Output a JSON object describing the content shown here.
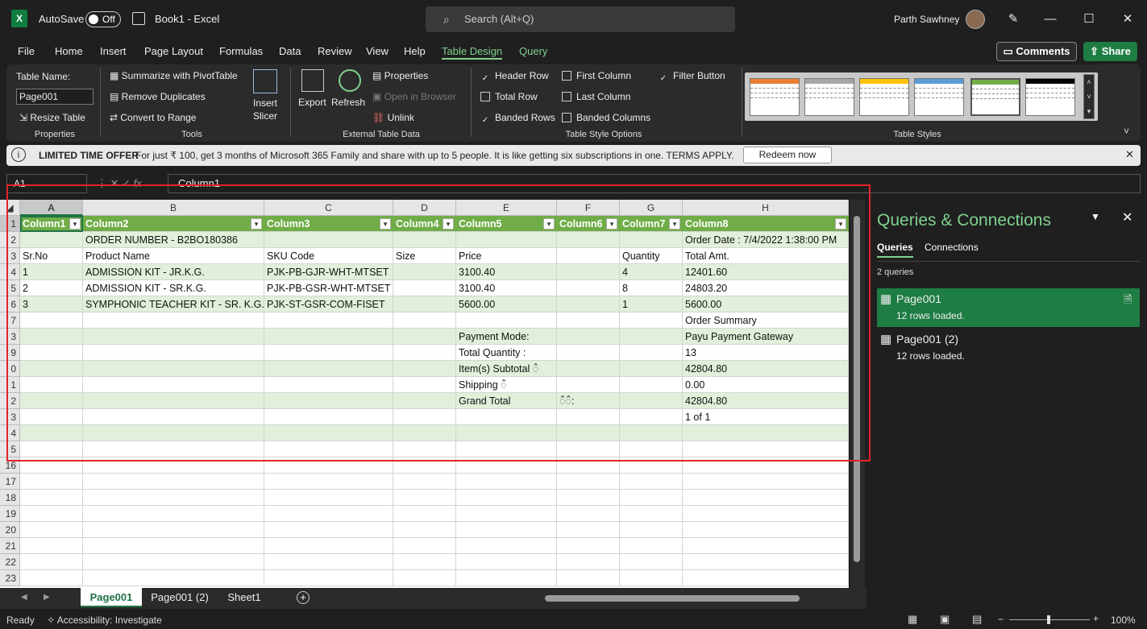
{
  "titlebar": {
    "autosave": "AutoSave",
    "toggle": "Off",
    "doc": "Book1  -  Excel",
    "search": "Search (Alt+Q)",
    "user": "Parth Sawhney"
  },
  "menu": {
    "items": [
      "File",
      "Home",
      "Insert",
      "Page Layout",
      "Formulas",
      "Data",
      "Review",
      "View",
      "Help",
      "Table Design",
      "Query"
    ],
    "comments": "Comments",
    "share": "Share"
  },
  "ribbon": {
    "properties": {
      "table_name_label": "Table Name:",
      "table_name": "Page001",
      "resize": "Resize Table",
      "group": "Properties"
    },
    "tools": {
      "pivot": "Summarize with PivotTable",
      "dupes": "Remove Duplicates",
      "convert": "Convert to Range",
      "slicer": "Insert Slicer",
      "group": "Tools"
    },
    "external": {
      "export": "Export",
      "refresh": "Refresh",
      "properties": "Properties",
      "open_browser": "Open in Browser",
      "unlink": "Unlink",
      "group": "External Table Data"
    },
    "style_options": {
      "header_row": "Header Row",
      "total_row": "Total Row",
      "banded_rows": "Banded Rows",
      "first_column": "First Column",
      "last_column": "Last Column",
      "banded_columns": "Banded Columns",
      "filter_button": "Filter Button",
      "group": "Table Style Options"
    },
    "styles": {
      "group": "Table Styles"
    }
  },
  "infobar": {
    "title": "LIMITED TIME OFFER",
    "message": "For just ₹ 100, get 3 months of Microsoft 365 Family and share with up to 5 people. It is like getting six subscriptions in one. TERMS APPLY.",
    "button": "Redeem now"
  },
  "formula": {
    "namebox": "A1",
    "value": "Column1",
    "fx": "fx"
  },
  "columns": [
    "A",
    "B",
    "C",
    "D",
    "E",
    "F",
    "G",
    "H"
  ],
  "rows": [
    "1",
    "2",
    "3",
    "4",
    "5",
    "6",
    "7",
    "8",
    "9",
    "10",
    "11",
    "12",
    "13",
    "14",
    "15",
    "16",
    "17",
    "18",
    "19",
    "20",
    "21",
    "22",
    "23"
  ],
  "rows_visible": [
    "1",
    "2",
    "3",
    "4",
    "5",
    "6",
    "7",
    "3",
    "9",
    "0",
    "1",
    "2",
    "3",
    "4",
    "5",
    "16",
    "17",
    "18",
    "19",
    "20",
    "21",
    "22",
    "23"
  ],
  "table": [
    [
      "Column1",
      "Column2",
      "Column3",
      "Column4",
      "Column5",
      "Column6",
      "Column7",
      "Column8"
    ],
    [
      "",
      "ORDER NUMBER - B2BO180386",
      "",
      "",
      "",
      "",
      "",
      "Order Date : 7/4/2022 1:38:00 PM"
    ],
    [
      "Sr.No",
      "Product Name",
      "SKU Code",
      "Size",
      "Price",
      "",
      "Quantity",
      "Total Amt."
    ],
    [
      "1",
      "ADMISSION KIT - JR.K.G.",
      "PJK-PB-GJR-WHT-MTSET",
      "",
      "3100.40",
      "",
      "4",
      "12401.60"
    ],
    [
      "2",
      "ADMISSION KIT - SR.K.G.",
      "PJK-PB-GSR-WHT-MTSET",
      "",
      "3100.40",
      "",
      "8",
      "24803.20"
    ],
    [
      "3",
      "SYMPHONIC TEACHER KIT - SR. K.G.",
      "PJK-ST-GSR-COM-FISET",
      "",
      "5600.00",
      "",
      "1",
      "5600.00"
    ],
    [
      "",
      "",
      "",
      "",
      "",
      "",
      "",
      "Order Summary"
    ],
    [
      "",
      "",
      "",
      "",
      "Payment Mode:",
      "",
      "",
      "Payu Payment Gateway"
    ],
    [
      "",
      "",
      "",
      "",
      "Total Quantity :",
      "",
      "",
      "13"
    ],
    [
      "",
      "",
      "",
      "",
      "Item(s) Subtotal ꠆",
      "",
      "",
      "42804.80"
    ],
    [
      "",
      "",
      "",
      "",
      "Shipping ꠆",
      "",
      "",
      "0.00"
    ],
    [
      "",
      "",
      "",
      "",
      "Grand Total",
      "꠆꠆:",
      "",
      "42804.80"
    ],
    [
      "",
      "",
      "",
      "",
      "",
      "",
      "",
      "1 of 1"
    ],
    [
      "",
      "",
      "",
      "",
      "",
      "",
      "",
      ""
    ],
    [
      "",
      "",
      "",
      "",
      "",
      "",
      "",
      ""
    ]
  ],
  "sheets": [
    "Page001",
    "Page001 (2)",
    "Sheet1"
  ],
  "queries": {
    "title": "Queries & Connections",
    "tab_queries": "Queries",
    "tab_connections": "Connections",
    "count": "2 queries",
    "items": [
      {
        "name": "Page001",
        "status": "12 rows loaded."
      },
      {
        "name": "Page001 (2)",
        "status": "12 rows loaded."
      }
    ]
  },
  "status": {
    "ready": "Ready",
    "accessibility": "Accessibility: Investigate",
    "zoom": "100%"
  }
}
